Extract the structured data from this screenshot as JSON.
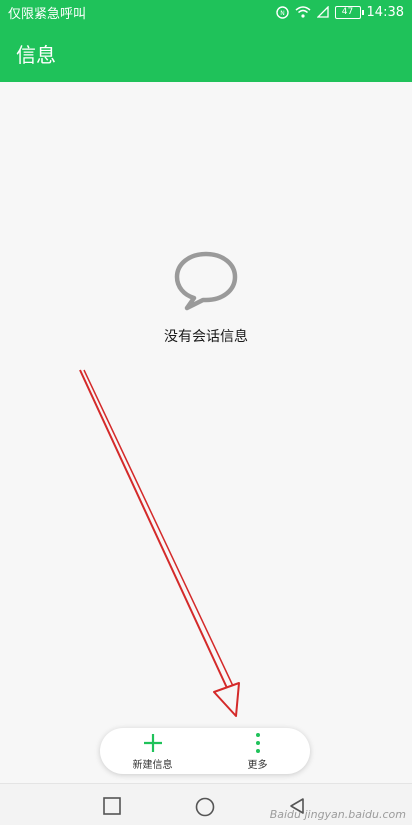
{
  "status_bar": {
    "left_text": "仅限紧急呼叫",
    "battery": "47",
    "time": "14:38"
  },
  "app_bar": {
    "title": "信息"
  },
  "empty_state": {
    "message": "没有会话信息",
    "icon": "chat-bubble-icon"
  },
  "bottom_actions": {
    "new_message_label": "新建信息",
    "more_label": "更多"
  },
  "nav_bar": {
    "icons": [
      "square-recent-icon",
      "circle-home-icon",
      "triangle-back-icon"
    ]
  },
  "watermark": {
    "text": "Baidu jingyan.baidu.com"
  },
  "colors": {
    "accent": "#1fc25a",
    "arrow": "#d42a2a"
  }
}
